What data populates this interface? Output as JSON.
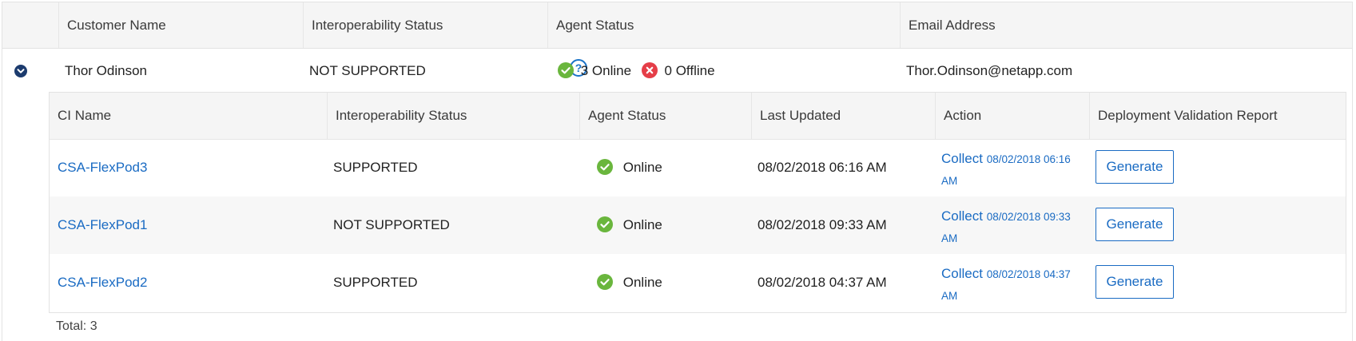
{
  "outer_header": {
    "customer_name": "Customer Name",
    "interop_status": "Interoperability Status",
    "agent_status": "Agent Status",
    "email": "Email Address"
  },
  "customer": {
    "name": "Thor Odinson",
    "interop": "NOT SUPPORTED",
    "online": "3 Online",
    "offline": "0 Offline",
    "email": "Thor.Odinson@netapp.com"
  },
  "inner_header": {
    "ci_name": "CI Name",
    "interop_status": "Interoperability Status",
    "agent_status": "Agent Status",
    "last_updated": "Last Updated",
    "action": "Action",
    "report": "Deployment Validation Report"
  },
  "rows": [
    {
      "ci": "CSA-FlexPod3",
      "interop": "SUPPORTED",
      "agent": "Online",
      "updated": "08/02/2018 06:16 AM",
      "collect": "Collect",
      "collect_date": "08/02/2018 06:16 AM",
      "generate": "Generate"
    },
    {
      "ci": "CSA-FlexPod1",
      "interop": "NOT SUPPORTED",
      "agent": "Online",
      "updated": "08/02/2018 09:33 AM",
      "collect": "Collect",
      "collect_date": "08/02/2018 09:33 AM",
      "generate": "Generate"
    },
    {
      "ci": "CSA-FlexPod2",
      "interop": "SUPPORTED",
      "agent": "Online",
      "updated": "08/02/2018 04:37 AM",
      "collect": "Collect",
      "collect_date": "08/02/2018 04:37 AM",
      "generate": "Generate"
    }
  ],
  "total": "Total: 3",
  "icons": {
    "expand": "chevron-down-icon",
    "help": "question-circle-icon",
    "online": "check-circle-icon",
    "offline": "x-circle-icon"
  },
  "colors": {
    "link": "#1a6bc3",
    "online": "#6ab63d",
    "offline": "#e53e48",
    "expand": "#1c3b6e"
  }
}
